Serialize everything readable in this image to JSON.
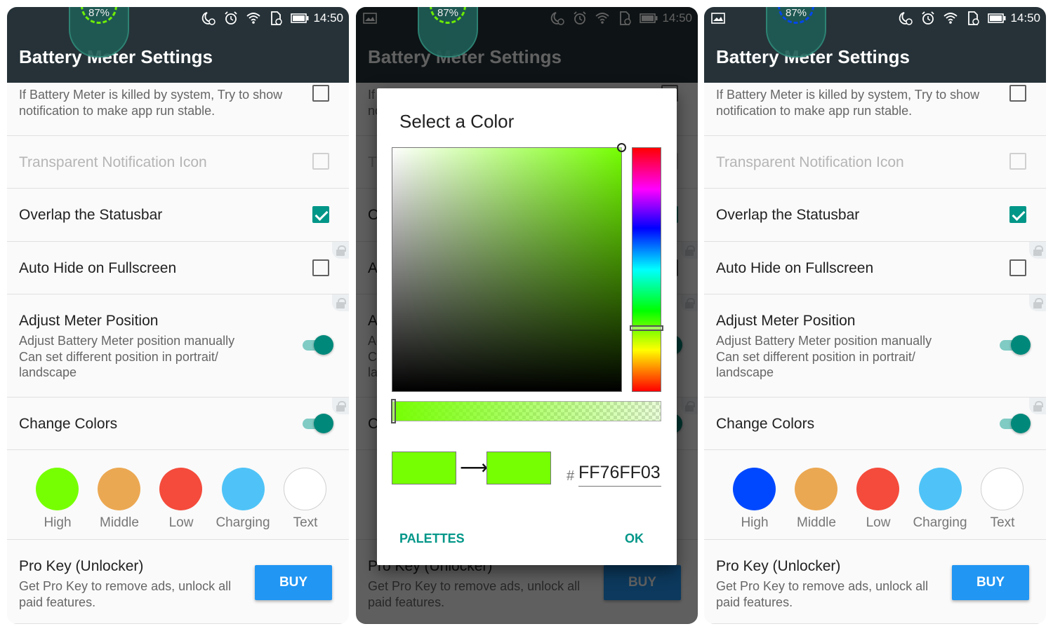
{
  "status_bar": {
    "time": "14:50",
    "battery_meter_percent": "87%"
  },
  "app": {
    "title": "Battery Meter Settings"
  },
  "settings": {
    "notify_description": "If Battery Meter is killed by system, Try to show notification to make app run stable.",
    "transparent_icon": "Transparent Notification Icon",
    "overlap_statusbar": "Overlap the Statusbar",
    "auto_hide": "Auto Hide on Fullscreen",
    "adjust_position": {
      "title": "Adjust Meter Position",
      "line1": "Adjust Battery Meter position manually",
      "line2": "Can set different position in portrait/",
      "line3": "landscape"
    },
    "change_colors": "Change Colors",
    "color_labels": [
      "High",
      "Middle",
      "Low",
      "Charging",
      "Text"
    ],
    "pro_key": {
      "title": "Pro Key (Unlocker)",
      "line1": "Get Pro Key to remove ads, unlock all",
      "line2": "paid features.",
      "buy_label": "BUY"
    }
  },
  "dialog": {
    "title": "Select a Color",
    "hash": "#",
    "hex_value": "FF76FF03",
    "arrow": "⟶",
    "palettes_label": "PALETTES",
    "ok_label": "OK"
  },
  "colors": {
    "appbar": "#263238",
    "accent": "#009688",
    "buy_button": "#2196f3",
    "selected_color": "#76ff03",
    "screen1_swatches": [
      "#76ff03",
      "#eba852",
      "#f44b3c",
      "#4fc3f7",
      "#ffffff"
    ],
    "screen3_swatches": [
      "#0048ff",
      "#eba852",
      "#f44b3c",
      "#4fc3f7",
      "#ffffff"
    ],
    "meter_ring_screen1": "#76ff03",
    "meter_ring_screen3": "#0048ff"
  },
  "icons": [
    "image-icon",
    "moon-icon",
    "alarm-icon",
    "wifi-icon",
    "sim-icon",
    "battery-icon",
    "lock-icon"
  ],
  "state": {
    "overlap_statusbar_checked": true,
    "auto_hide_checked": false,
    "adjust_position_on": true,
    "change_colors_on": true
  }
}
